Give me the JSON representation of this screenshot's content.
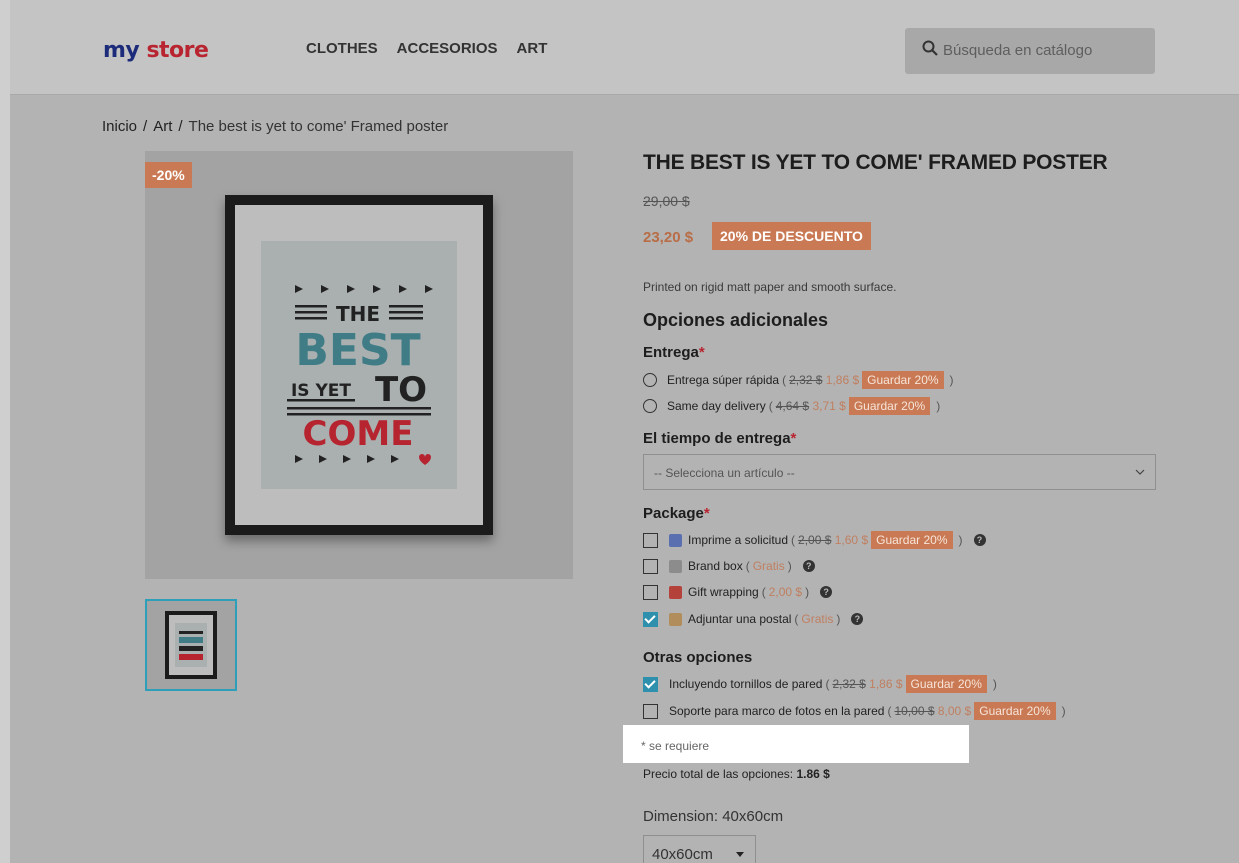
{
  "header": {
    "logo_part1": "my",
    "logo_part2": "store",
    "nav": [
      "CLOTHES",
      "ACCESORIOS",
      "ART"
    ],
    "search_placeholder": "Búsqueda en catálogo"
  },
  "breadcrumb": {
    "items": [
      "Inicio",
      "Art",
      "The best is yet to come' Framed poster"
    ],
    "separator": "/"
  },
  "product": {
    "discount_badge": "-20%",
    "title": "THE BEST IS YET TO COME' FRAMED POSTER",
    "old_price": "29,00 $",
    "price": "23,20 $",
    "discount_label": "20% DE DESCUENTO",
    "description": "Printed on rigid matt paper and smooth surface.",
    "poster_text": {
      "line1": "THE",
      "line2": "BEST",
      "line3a": "IS YET",
      "line3b": "TO",
      "line4": "COME"
    }
  },
  "options": {
    "heading": "Opciones adicionales",
    "required_mark": "*",
    "delivery": {
      "label": "Entrega",
      "items": [
        {
          "name": "Entrega súper rápida",
          "old": "2,32 $",
          "new": "1,86 $",
          "save": "Guardar 20%"
        },
        {
          "name": "Same day delivery",
          "old": "4,64 $",
          "new": "3,71 $",
          "save": "Guardar 20%"
        }
      ]
    },
    "delivery_time": {
      "label": "El tiempo de entrega",
      "select_value": "-- Selecciona un artículo --"
    },
    "package": {
      "label": "Package",
      "items": [
        {
          "name": "Imprime a solicitud",
          "old": "2,00 $",
          "new": "1,60 $",
          "save": "Guardar 20%",
          "checked": false
        },
        {
          "name": "Brand box",
          "price": "Gratis",
          "checked": false
        },
        {
          "name": "Gift wrapping",
          "price": "2,00 $",
          "checked": false
        },
        {
          "name": "Adjuntar una postal",
          "price": "Gratis",
          "checked": true
        }
      ]
    },
    "other": {
      "label": "Otras opciones",
      "items": [
        {
          "name": "Incluyendo tornillos de pared",
          "old": "2,32 $",
          "new": "1,86 $",
          "save": "Guardar 20%",
          "checked": true
        },
        {
          "name": "Soporte para marco de fotos en la pared",
          "old": "10,00 $",
          "new": "8,00 $",
          "save": "Guardar 20%",
          "checked": false
        }
      ]
    },
    "required_note": "* se requiere",
    "total_label": "Precio total de las opciones:",
    "total_value": "1.86 $"
  },
  "dimension": {
    "label": "Dimension: 40x60cm",
    "select_value": "40x60cm"
  },
  "colors": {
    "accent": "#c97a54",
    "checkbox": "#2e90ad",
    "required": "#b8242f"
  }
}
